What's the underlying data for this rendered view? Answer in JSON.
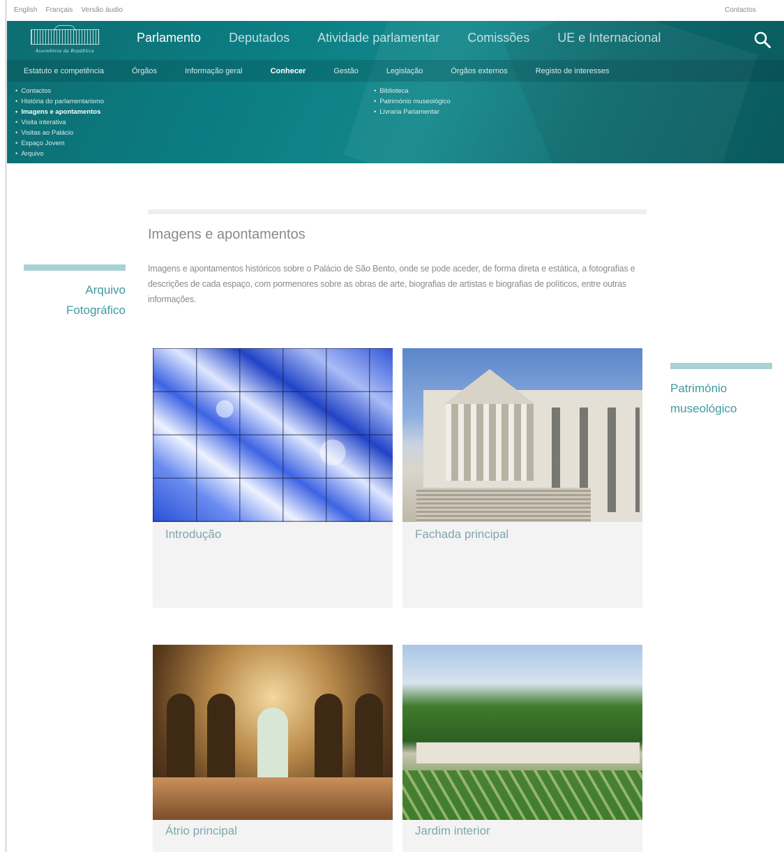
{
  "utility": {
    "languages": [
      "English",
      "Français",
      "Versão áudio"
    ],
    "contact": "Contactos"
  },
  "logo": {
    "text": "Assembleia da República"
  },
  "main_nav": [
    {
      "label": "Parlamento",
      "active": true
    },
    {
      "label": "Deputados",
      "active": false
    },
    {
      "label": "Atividade parlamentar",
      "active": false
    },
    {
      "label": "Comissões",
      "active": false
    },
    {
      "label": "UE e Internacional",
      "active": false
    }
  ],
  "sub_nav": [
    {
      "label": "Estatuto e competência"
    },
    {
      "label": "Órgãos"
    },
    {
      "label": "Informação geral"
    },
    {
      "label": "Conhecer",
      "active": true
    },
    {
      "label": "Gestão"
    },
    {
      "label": "Legislação"
    },
    {
      "label": "Órgãos externos"
    },
    {
      "label": "Registo de interesses"
    }
  ],
  "menu_col1": [
    "Contactos",
    "História do parlamentarismo",
    "Imagens e apontamentos",
    "Visita interativa",
    "Visitas ao Palácio",
    "Espaço Jovem",
    "Arquivo"
  ],
  "menu_col2": [
    "Biblioteca",
    "Património museológico",
    "Livraria Parlamentar"
  ],
  "content": {
    "title": "Imagens e apontamentos",
    "intro": "Imagens e apontamentos históricos sobre o Palácio de São Bento, onde se pode aceder, de forma direta e estática, a fotografias e descrições de cada espaço, com pormenores sobre as obras de arte, biografias de artistas e biografias de políticos, entre outras informações."
  },
  "side_left": {
    "line1": "Arquivo",
    "line2": "Fotográfico"
  },
  "side_right": {
    "line1": "Património",
    "line2": "museológico"
  },
  "cards": [
    {
      "caption": "Introdução"
    },
    {
      "caption": "Fachada principal"
    },
    {
      "caption": "Átrio principal"
    },
    {
      "caption": "Jardim interior"
    }
  ],
  "colors": {
    "header": "#0b7d82",
    "accent_bar": "#a8d2d4",
    "link": "#3e9aa0"
  }
}
